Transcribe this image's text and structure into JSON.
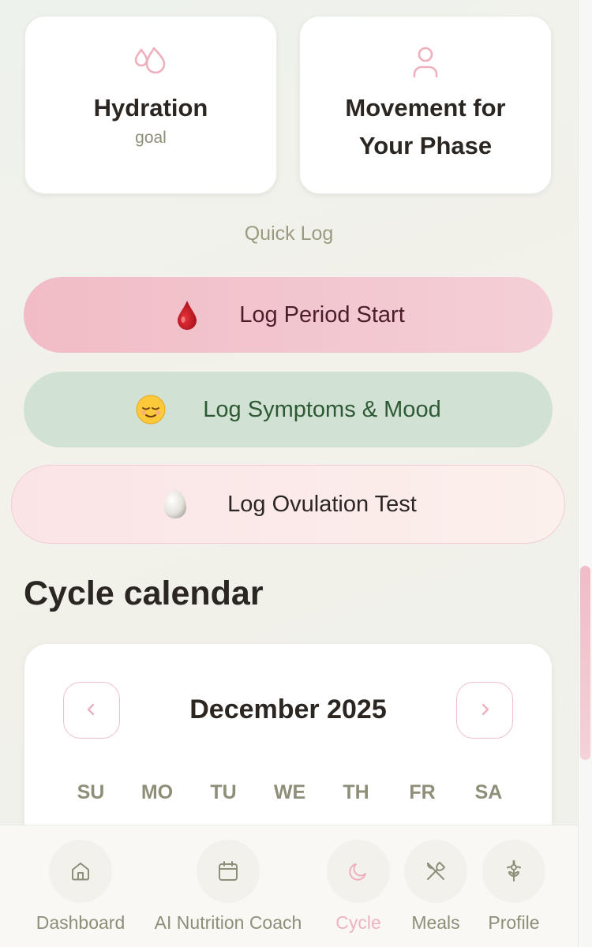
{
  "cards": [
    {
      "title": "Hydration",
      "subtitle": "goal",
      "icon": "droplets-icon"
    },
    {
      "title": "Movement for Your Phase",
      "title_line1": "Movement for",
      "title_line2": "Your Phase",
      "icon": "person-icon"
    }
  ],
  "quick_log": {
    "heading": "Quick Log",
    "buttons": [
      {
        "label": "Log Period Start",
        "emoji": "blood-drop-emoji"
      },
      {
        "label": "Log Symptoms & Mood",
        "emoji": "relieved-face-emoji"
      },
      {
        "label": "Log Ovulation Test",
        "emoji": "egg-emoji"
      }
    ]
  },
  "calendar": {
    "section_title": "Cycle calendar",
    "month": "December 2025",
    "weekdays": [
      "SU",
      "MO",
      "TU",
      "WE",
      "TH",
      "FR",
      "SA"
    ]
  },
  "bottom_nav": [
    {
      "label": "Dashboard",
      "icon": "home-icon",
      "active": false
    },
    {
      "label": "AI Nutrition Coach",
      "icon": "calendar-icon",
      "active": false
    },
    {
      "label": "Cycle",
      "icon": "moon-icon",
      "active": true
    },
    {
      "label": "Meals",
      "icon": "utensils-icon",
      "active": false
    },
    {
      "label": "Profile",
      "icon": "flower-icon",
      "active": false
    }
  ],
  "colors": {
    "accent_pink": "#eeb3c0",
    "muted_text": "#8f8e79",
    "dark_text": "#2b2622",
    "sage_green": "#d1e2d5"
  }
}
